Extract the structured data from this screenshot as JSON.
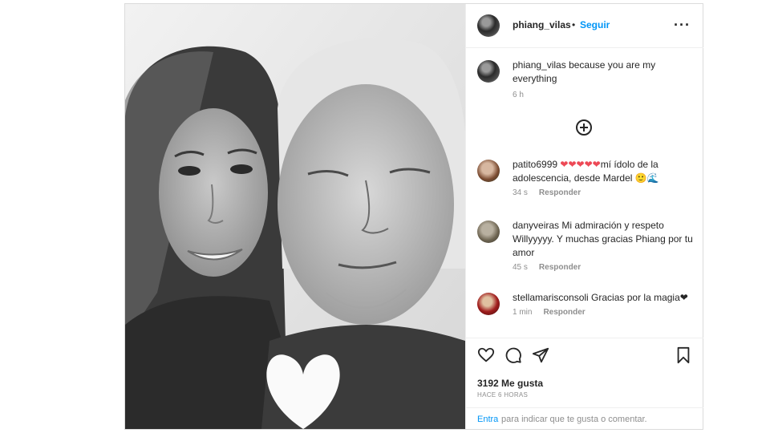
{
  "post": {
    "author": "phiang_vilas",
    "follow_label": "Seguir",
    "more_icon": "more-horizontal-icon",
    "caption_text": "because you are my everything",
    "caption_time": "6 h",
    "load_more_icon": "plus-circle-icon"
  },
  "comments": [
    {
      "user": "patito6999",
      "text_hearts": "❤❤❤❤❤",
      "text": "mí ídolo de la adolescencia, desde Mardel 🙂🌊",
      "time": "34 s",
      "reply": "Responder"
    },
    {
      "user": "danyveiras",
      "text": "Mi admiración y respeto Willyyyyy. Y muchas gracias Phiang por tu amor",
      "time": "45 s",
      "reply": "Responder"
    },
    {
      "user": "stellamarisconsoli",
      "text": "Gracias por la magia❤",
      "time": "1 min",
      "reply": "Responder"
    }
  ],
  "actions": {
    "like_icon": "heart-icon",
    "comment_icon": "comment-icon",
    "share_icon": "send-icon",
    "save_icon": "bookmark-icon"
  },
  "likes": "3192 Me gusta",
  "posted_ago": "HACE 6 HORAS",
  "add_comment": {
    "enter": "Entra",
    "rest": "para indicar que te gusta o comentar."
  },
  "colors": {
    "link": "#0095f6",
    "text": "#262626",
    "muted": "#8e8e8e",
    "heart": "#ed4956"
  }
}
